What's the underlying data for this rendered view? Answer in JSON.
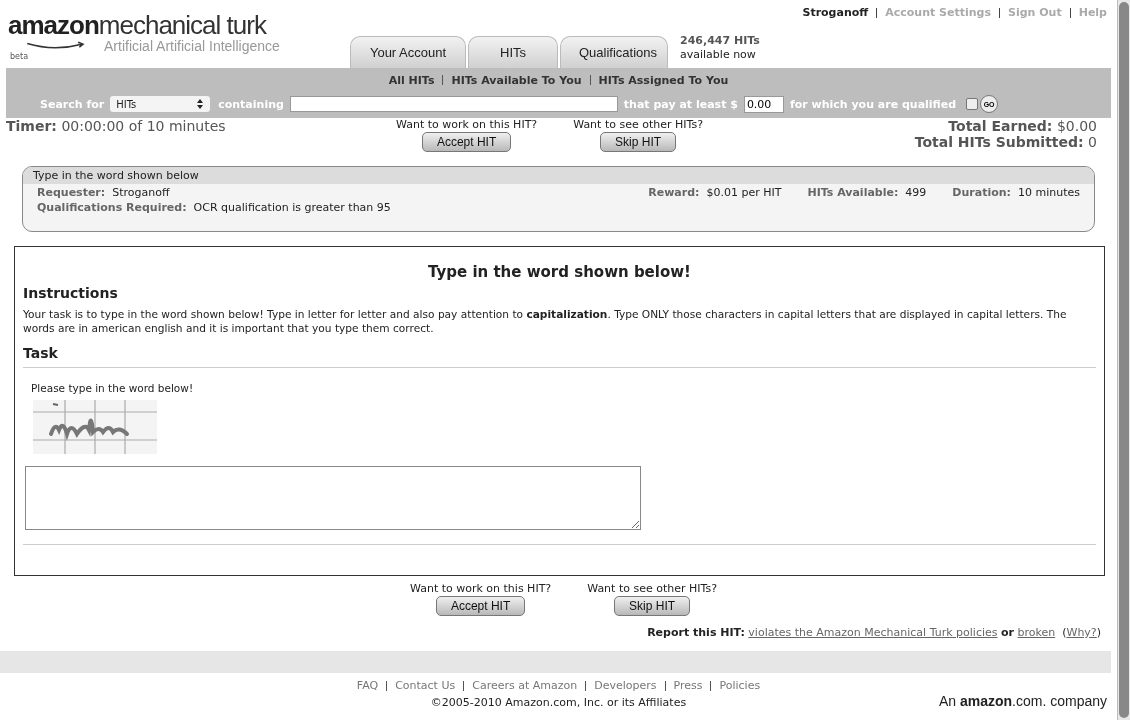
{
  "header": {
    "logo_bold": "amazon",
    "logo_light": "mechanical turk",
    "tagline": "Artificial Artificial Intelligence",
    "beta": "beta",
    "tabs": [
      {
        "label": "Your Account",
        "selected": false
      },
      {
        "label": "HITs",
        "selected": false
      },
      {
        "label": "Qualifications",
        "selected": false
      }
    ],
    "hits_count": "246,447 HITs",
    "hits_note": "available now",
    "user_links": [
      {
        "label": "Stroganoff",
        "kind": "user"
      },
      {
        "label": "Account Settings",
        "kind": "link"
      },
      {
        "label": "Sign Out",
        "kind": "link"
      },
      {
        "label": "Help",
        "kind": "link"
      }
    ]
  },
  "nav": [
    "All HITs",
    "HITs Available To You",
    "HITs Assigned To You"
  ],
  "search": {
    "label_search": "Search for",
    "type_value": "HITs",
    "label_containing": "containing",
    "label_pay": "that pay at least $",
    "pay_value": "0.00",
    "label_qualified": "for which you are qualified",
    "qualified_checked": false,
    "go": "GO"
  },
  "timer": {
    "label": "Timer:",
    "value": "00:00:00 of 10 minutes"
  },
  "actions_top": {
    "accept_prompt": "Want to work on this HIT?",
    "accept": "Accept HIT",
    "skip_prompt": "Want to see other HITs?",
    "skip": "Skip HIT"
  },
  "totals": [
    {
      "label": "Total Earned:",
      "value": "$0.00"
    },
    {
      "label": "Total HITs Submitted:",
      "value": "0"
    }
  ],
  "hit_info": {
    "title": "Type in the word shown below",
    "requester_label": "Requester:",
    "requester": "Stroganoff",
    "reward_label": "Reward:",
    "reward": "$0.01 per HIT",
    "available_label": "HITs Available:",
    "available": "499",
    "duration_label": "Duration:",
    "duration": "10 minutes",
    "qual_label": "Qualifications Required:",
    "qual": "OCR qualification is greater than 95"
  },
  "task": {
    "heading": "Type in the word shown below!",
    "instructions_heading": "Instructions",
    "instructions": "Your task is to type in the word shown below! Type in letter for letter and also pay attention to **capitalization**. Type ONLY those characters in capital letters that are displayed in capital letters. The words are in american english and it is important that you type them correct.",
    "task_heading": "Task",
    "prompt": "Please type in the word below!"
  },
  "actions_bottom": {
    "accept_prompt": "Want to work on this HIT?",
    "accept": "Accept HIT",
    "skip_prompt": "Want to see other HITs?",
    "skip": "Skip HIT"
  },
  "report": {
    "label": "Report this HIT:",
    "link_policies": "violates the Amazon Mechanical Turk policies",
    "or": "or",
    "link_broken": "broken",
    "why_open": "(",
    "why": "Why?",
    "why_close": ")"
  },
  "footer": {
    "links": [
      "FAQ",
      "Contact Us",
      "Careers at Amazon",
      "Developers",
      "Press",
      "Policies"
    ],
    "copyright": "©2005-2010 Amazon.com, Inc. or its Affiliates",
    "company": "An **amazon**.com. company"
  }
}
